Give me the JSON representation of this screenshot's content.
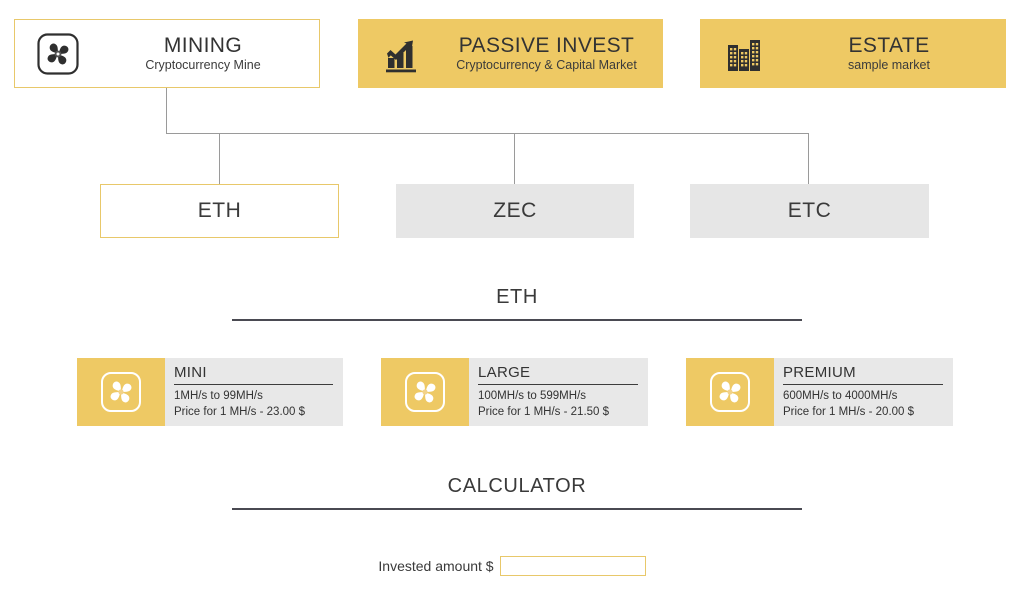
{
  "categories": [
    {
      "title": "MINING",
      "subtitle": "Cryptocurrency Mine",
      "icon": "fan-icon",
      "selected": true
    },
    {
      "title": "PASSIVE INVEST",
      "subtitle": "Cryptocurrency & Capital Market",
      "icon": "bar-chart-growth-icon",
      "selected": false
    },
    {
      "title": "ESTATE",
      "subtitle": "sample market",
      "icon": "buildings-icon",
      "selected": false
    }
  ],
  "coins": [
    {
      "label": "ETH",
      "selected": true
    },
    {
      "label": "ZEC",
      "selected": false
    },
    {
      "label": "ETC",
      "selected": false
    }
  ],
  "sections": {
    "coin_heading": "ETH",
    "calculator_heading": "CALCULATOR"
  },
  "plans": [
    {
      "name": "MINI",
      "range": "1MH/s to 99MH/s",
      "price": "Price for 1 MH/s - 23.00 $",
      "icon": "fan-icon"
    },
    {
      "name": "LARGE",
      "range": "100MH/s to 599MH/s",
      "price": "Price for 1 MH/s - 21.50 $",
      "icon": "fan-icon"
    },
    {
      "name": "PREMIUM",
      "range": "600MH/s to 4000MH/s",
      "price": "Price for 1 MH/s - 20.00 $",
      "icon": "fan-icon"
    }
  ],
  "calculator": {
    "label": "Invested amount $",
    "value": "",
    "placeholder": ""
  },
  "colors": {
    "gold": "#eec964",
    "gold_border": "#e8c86a",
    "gray_fill": "#e6e6e6",
    "plan_body": "#e8e8e8",
    "rule": "#4a4a52",
    "connector": "#9a9a9a",
    "text": "#3a3a3a"
  }
}
